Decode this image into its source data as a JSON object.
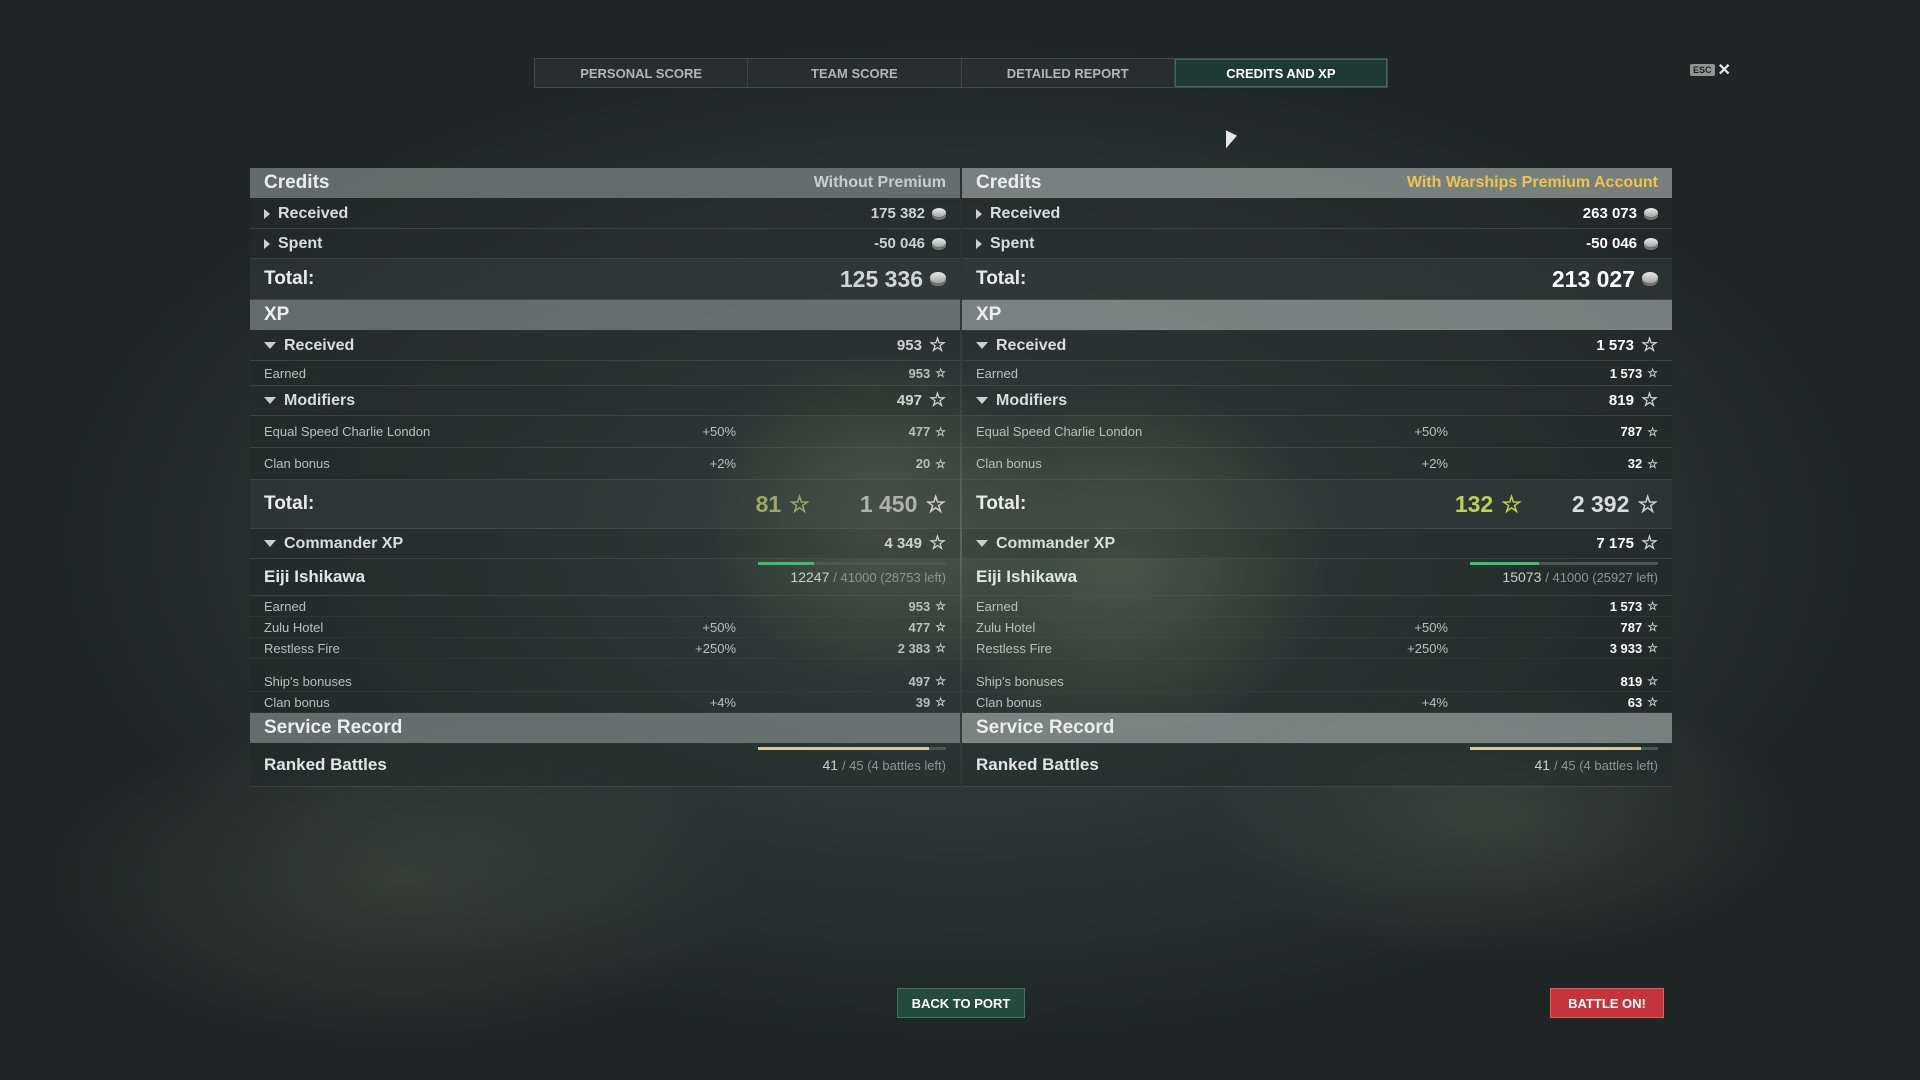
{
  "tabs": [
    "PERSONAL SCORE",
    "TEAM SCORE",
    "DETAILED REPORT",
    "CREDITS AND XP"
  ],
  "active_tab": "CREDITS AND XP",
  "esc": {
    "key": "ESC",
    "close": "✕"
  },
  "icons": {
    "credits": "silver-coin-icon",
    "xp": "star-icon",
    "expand": "triangle-right-icon",
    "collapse": "triangle-down-icon"
  },
  "colors": {
    "premium_label": "#f2c24a",
    "xp_bonus": "#b8d44f",
    "commander_bar": "#3fbf6a",
    "battle_button": "#c6343b",
    "port_button": "#244b3e"
  },
  "left": {
    "credits_title": "Credits",
    "account": "Without Premium",
    "received_label": "Received",
    "received": "175 382",
    "spent_label": "Spent",
    "spent": "-50 046",
    "total_label": "Total:",
    "total": "125 336",
    "xp_title": "XP",
    "xp_received_label": "Received",
    "xp_received": "953",
    "earned_label": "Earned",
    "earned": "953",
    "modifiers_label": "Modifiers",
    "modifiers": "497",
    "mods": [
      {
        "name": "Equal Speed Charlie London",
        "pct": "+50%",
        "value": "477"
      },
      {
        "name": "Clan bonus",
        "pct": "+2%",
        "value": "20"
      }
    ],
    "xp_total_label": "Total:",
    "xp_bonus": "81",
    "xp_total": "1 450",
    "commander_label": "Commander XP",
    "commander_xp": "4 349",
    "commander_name": "Eiji Ishikawa",
    "commander_progress_current": "12247",
    "commander_progress_rest": "/ 41000 (28753 left)",
    "commander_progress_fraction": 0.299,
    "cmd_earned_label": "Earned",
    "cmd_earned": "953",
    "cmd_rows": [
      {
        "name": "Zulu Hotel",
        "pct": "+50%",
        "value": "477"
      },
      {
        "name": "Restless Fire",
        "pct": "+250%",
        "value": "2 383"
      }
    ],
    "cmd_rows2": [
      {
        "name": "Ship's bonuses",
        "pct": "",
        "value": "497"
      },
      {
        "name": "Clan bonus",
        "pct": "+4%",
        "value": "39"
      }
    ],
    "service_title": "Service Record",
    "ranked_label": "Ranked Battles",
    "ranked_current": "41",
    "ranked_rest": "/ 45 (4 battles left)",
    "ranked_fraction": 0.911
  },
  "right": {
    "credits_title": "Credits",
    "account": "With Warships Premium Account",
    "received_label": "Received",
    "received": "263 073",
    "spent_label": "Spent",
    "spent": "-50 046",
    "total_label": "Total:",
    "total": "213 027",
    "xp_title": "XP",
    "xp_received_label": "Received",
    "xp_received": "1 573",
    "earned_label": "Earned",
    "earned": "1 573",
    "modifiers_label": "Modifiers",
    "modifiers": "819",
    "mods": [
      {
        "name": "Equal Speed Charlie London",
        "pct": "+50%",
        "value": "787"
      },
      {
        "name": "Clan bonus",
        "pct": "+2%",
        "value": "32"
      }
    ],
    "xp_total_label": "Total:",
    "xp_bonus": "132",
    "xp_total": "2 392",
    "commander_label": "Commander XP",
    "commander_xp": "7 175",
    "commander_name": "Eiji Ishikawa",
    "commander_progress_current": "15073",
    "commander_progress_rest": "/ 41000 (25927 left)",
    "commander_progress_fraction": 0.368,
    "cmd_earned_label": "Earned",
    "cmd_earned": "1 573",
    "cmd_rows": [
      {
        "name": "Zulu Hotel",
        "pct": "+50%",
        "value": "787"
      },
      {
        "name": "Restless Fire",
        "pct": "+250%",
        "value": "3 933"
      }
    ],
    "cmd_rows2": [
      {
        "name": "Ship's bonuses",
        "pct": "",
        "value": "819"
      },
      {
        "name": "Clan bonus",
        "pct": "+4%",
        "value": "63"
      }
    ],
    "service_title": "Service Record",
    "ranked_label": "Ranked Battles",
    "ranked_current": "41",
    "ranked_rest": "/ 45 (4 battles left)",
    "ranked_fraction": 0.911
  },
  "buttons": {
    "back_to_port": "BACK TO PORT",
    "battle_on": "BATTLE ON!"
  }
}
